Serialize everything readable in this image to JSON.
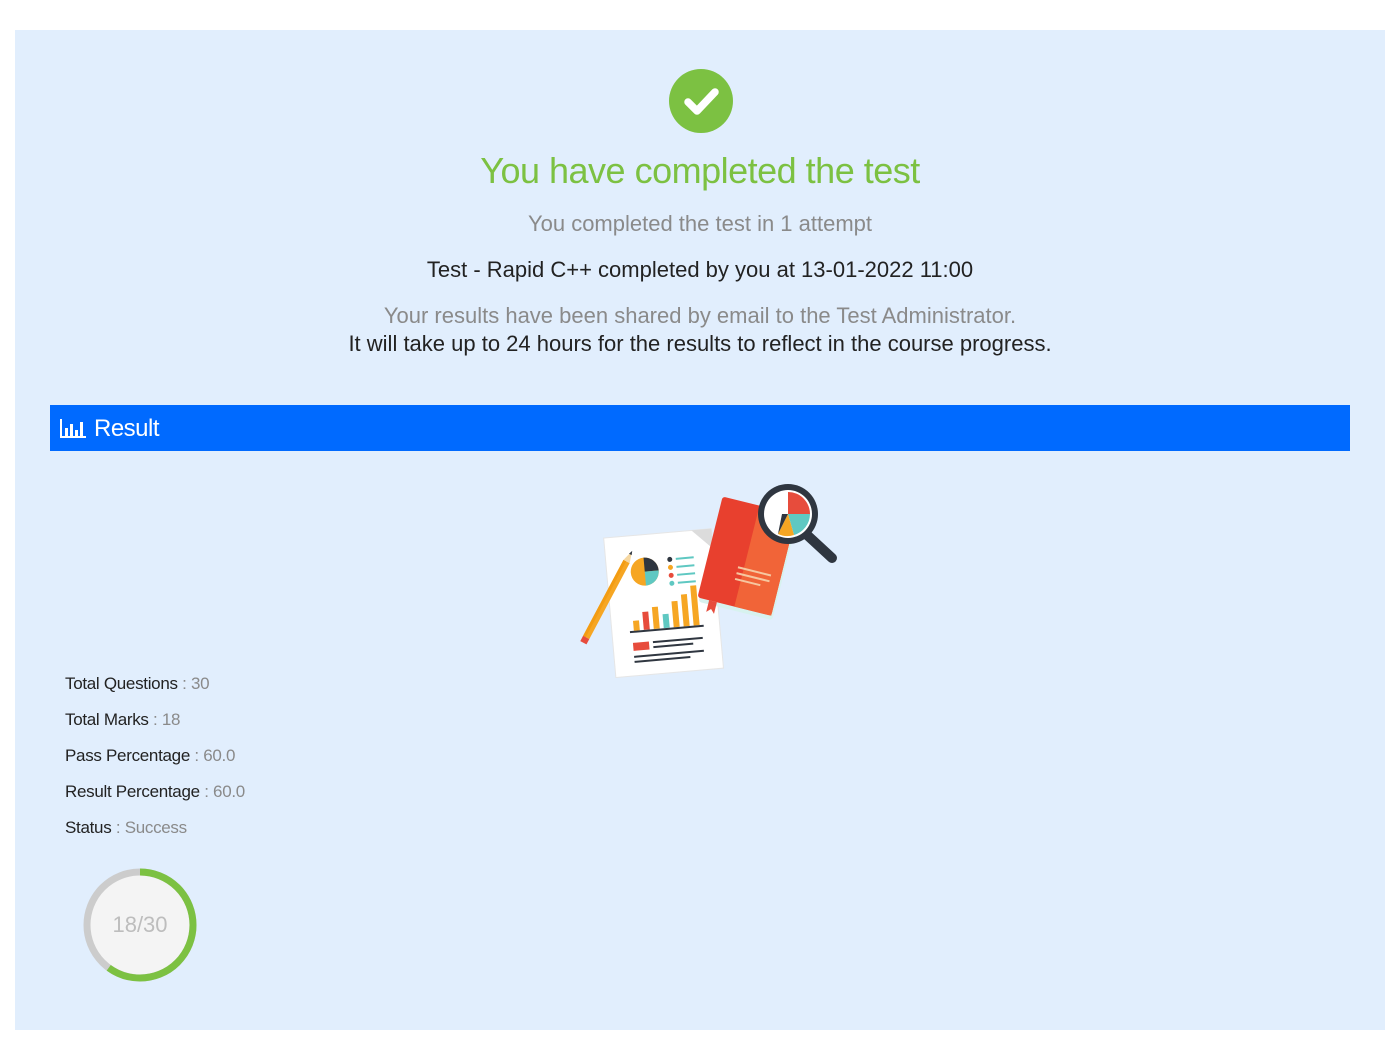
{
  "header": {
    "title": "You have completed the test",
    "attempts_text": "You completed the test in 1 attempt",
    "completed_text": "Test - Rapid C++ completed by you at 13-01-2022 11:00",
    "shared_text": "Your results have been shared by email to the Test Administrator.",
    "reflect_text": "It will take up to 24 hours for the results to reflect in the course progress."
  },
  "result_section": {
    "title": "Result",
    "icon": "bar-chart-icon",
    "illustration": "report-analysis-illustration"
  },
  "stats": [
    {
      "label": "Total Questions",
      "sep": " : ",
      "value": "30"
    },
    {
      "label": "Total Marks",
      "sep": " : ",
      "value": "18"
    },
    {
      "label": "Pass Percentage",
      "sep": " : ",
      "value": "60.0"
    },
    {
      "label": "Result Percentage",
      "sep": " : ",
      "value": "60.0"
    },
    {
      "label": "Status",
      "sep": " : ",
      "value": "Success"
    }
  ],
  "progress": {
    "text": "18/30",
    "fraction": 0.6
  },
  "colors": {
    "success_green": "#7cc142",
    "result_bar_blue": "#006aff",
    "panel_bg": "#e1eefd"
  }
}
